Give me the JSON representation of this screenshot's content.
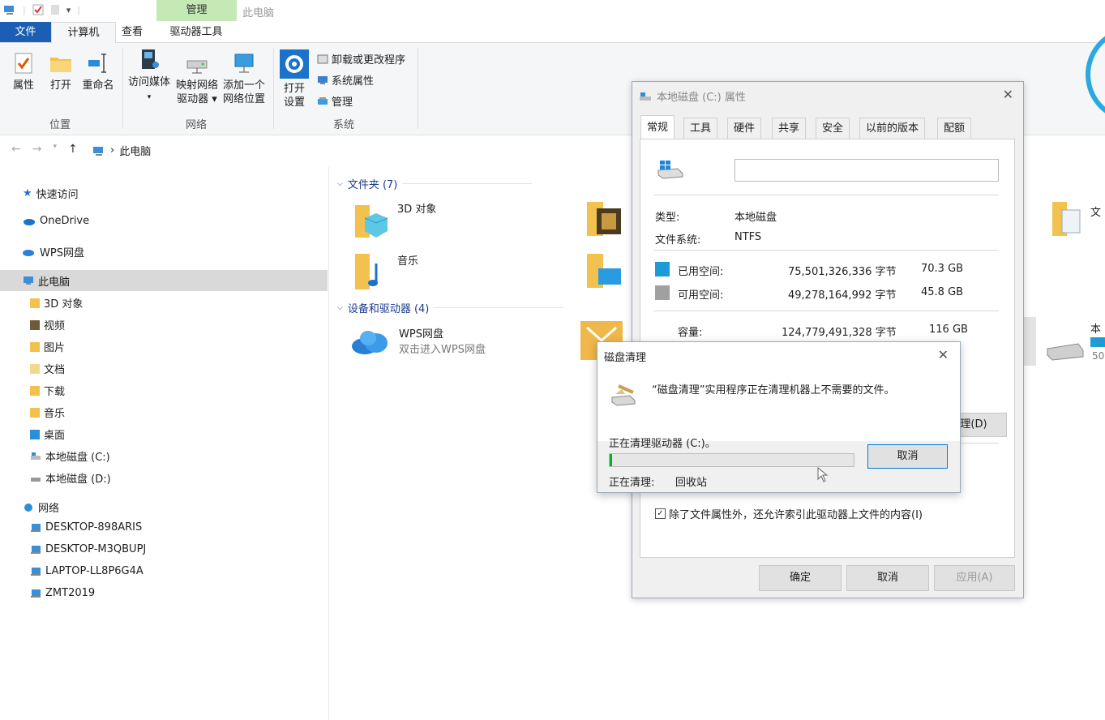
{
  "titlebar": {
    "contextual_tab": "管理",
    "window_title": "此电脑"
  },
  "tabs": {
    "file": "文件",
    "computer": "计算机",
    "view": "查看",
    "drive_tools": "驱动器工具"
  },
  "ribbon": {
    "location": {
      "label": "位置",
      "properties": "属性",
      "open": "打开",
      "rename": "重命名"
    },
    "network": {
      "label": "网络",
      "media_line1": "访问媒体",
      "map_line1": "映射网络",
      "map_line2": "驱动器 ▾",
      "add_line1": "添加一个",
      "add_line2": "网络位置"
    },
    "system": {
      "label": "系统",
      "open_line1": "打开",
      "open_line2": "设置",
      "uninstall": "卸载或更改程序",
      "sys_props": "系统属性",
      "manage": "管理"
    }
  },
  "address": {
    "crumb": "此电脑",
    "sep": "›"
  },
  "sidebar": {
    "quick_access": "快速访问",
    "onedrive": "OneDrive",
    "wps": "WPS网盘",
    "this_pc": "此电脑",
    "children": [
      "3D 对象",
      "视频",
      "图片",
      "文档",
      "下载",
      "音乐",
      "桌面",
      "本地磁盘 (C:)",
      "本地磁盘 (D:)"
    ],
    "network": "网络",
    "network_children": [
      "DESKTOP-898ARIS",
      "DESKTOP-M3QBUPJ",
      "LAPTOP-LL8P6G4A",
      "ZMT2019"
    ]
  },
  "content": {
    "folders_header": "文件夹 (7)",
    "folders": [
      "3D 对象",
      "音乐"
    ],
    "devices_header": "设备和驱动器 (4)",
    "wps_name": "WPS网盘",
    "wps_desc": "双击进入WPS网盘",
    "partial_doc": "文",
    "partial_local": "本",
    "partial_num": "50"
  },
  "props": {
    "title": "本地磁盘 (C:) 属性",
    "tabs": [
      "常规",
      "工具",
      "硬件",
      "共享",
      "安全",
      "以前的版本",
      "配额"
    ],
    "name_value": "",
    "type_label": "类型:",
    "type_value": "本地磁盘",
    "fs_label": "文件系统:",
    "fs_value": "NTFS",
    "used_label": "已用空间:",
    "used_bytes": "75,501,326,336 字节",
    "used_gb": "70.3 GB",
    "free_label": "可用空间:",
    "free_bytes": "49,278,164,992 字节",
    "free_gb": "45.8 GB",
    "cap_label": "容量:",
    "cap_bytes": "124,779,491,328 字节",
    "cap_gb": "116 GB",
    "cleanup_btn_partial": "理(D)",
    "index_checkbox": "除了文件属性外，还允许索引此驱动器上文件的内容(I)",
    "index_checked": true,
    "ok": "确定",
    "cancel": "取消",
    "apply": "应用(A)",
    "used_color": "#1e9bd7",
    "free_color": "#a0a0a0"
  },
  "cleanup": {
    "title": "磁盘清理",
    "message": "“磁盘清理”实用程序正在清理机器上不需要的文件。",
    "status": "正在清理驱动器  (C:)。",
    "progress": 0.01,
    "cleaning_label": "正在清理:",
    "cleaning_item": "回收站",
    "cancel": "取消"
  }
}
